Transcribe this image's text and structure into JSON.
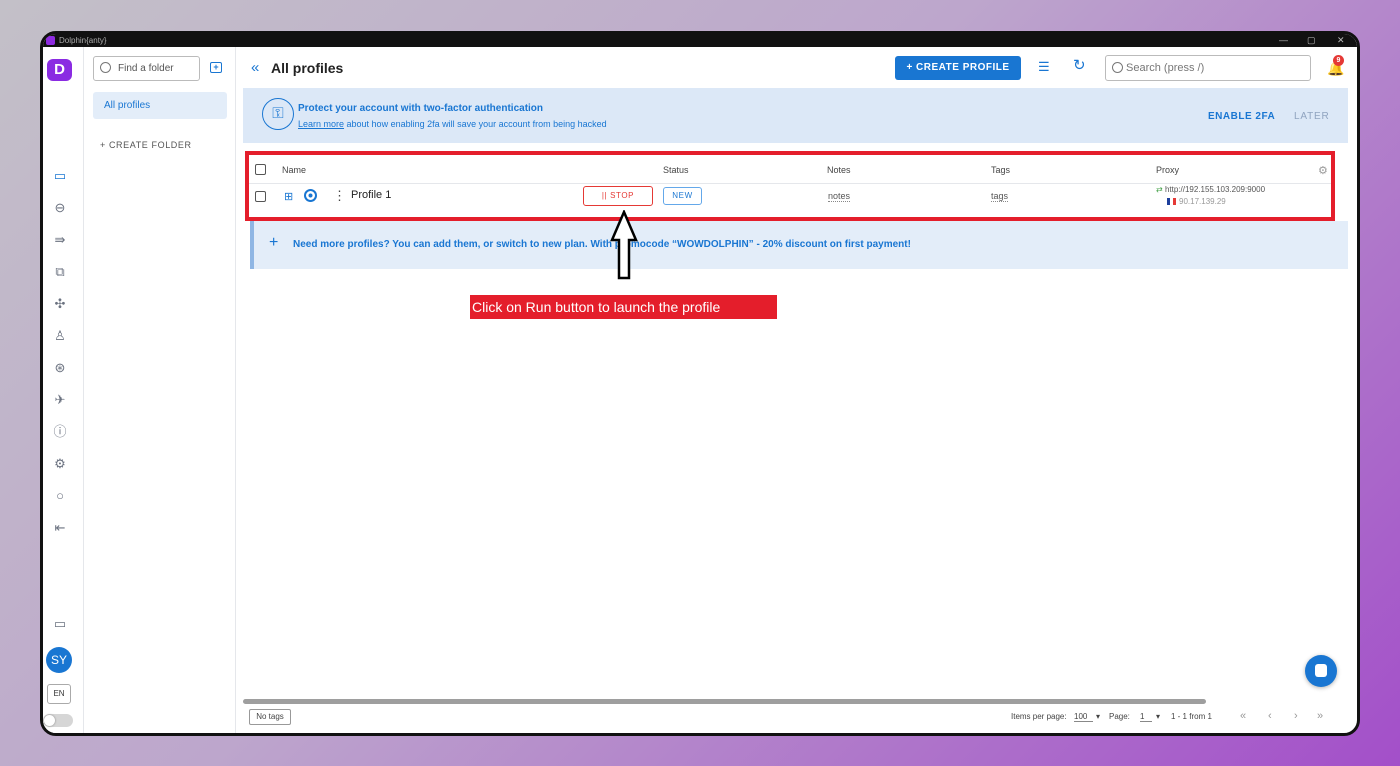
{
  "window": {
    "title": "Dolphin{anty}",
    "controls": [
      "—",
      "▢",
      "✕"
    ]
  },
  "rail": {
    "logo": "D",
    "icons": [
      "browser-profiles-icon",
      "link-icon",
      "share-icon",
      "copy-icon",
      "extensions-icon",
      "users-icon",
      "api-icon",
      "rocket-icon",
      "help-icon",
      "settings-icon",
      "lightbulb-icon",
      "logout-icon",
      "wallet-icon"
    ],
    "avatar": "SY",
    "lang": "EN"
  },
  "sidebar": {
    "search_placeholder": "Find a folder",
    "folders": [
      {
        "label": "All profiles",
        "active": true
      }
    ],
    "create_folder": "+ CREATE FOLDER"
  },
  "header": {
    "title": "All profiles",
    "create_button": "+ CREATE PROFILE",
    "search_placeholder": "Search (press /)",
    "notifications": "9"
  },
  "banner": {
    "title": "Protect your account with two-factor authentication",
    "link": "Learn more",
    "text": " about how enabling 2fa will save your account from being hacked",
    "enable": "ENABLE 2FA",
    "later": "LATER"
  },
  "table": {
    "columns": [
      "Name",
      "Status",
      "Notes",
      "Tags",
      "Proxy"
    ],
    "rows": [
      {
        "name": "Profile 1",
        "action": "|| STOP",
        "status": "NEW",
        "notes": "notes",
        "tags": "tags",
        "proxy": "http://192.155.103.209:9000",
        "proxy_ip": "90.17.139.29"
      }
    ]
  },
  "promo": {
    "text": "Need more profiles? You can add them, or switch to new plan. With promocode “WOWDOLPHIN” - 20% discount on first payment!"
  },
  "annotation": {
    "caption": "Click on Run button to launch the profile",
    "color": "#e41e2b"
  },
  "footer": {
    "no_tags": "No tags",
    "items_label": "Items per page:",
    "items_value": "100",
    "page_label": "Page:",
    "page_value": "1",
    "range": "1 - 1 from 1"
  },
  "colors": {
    "accent": "#1976d2",
    "brand": "#8a2be2",
    "danger": "#e53935"
  }
}
